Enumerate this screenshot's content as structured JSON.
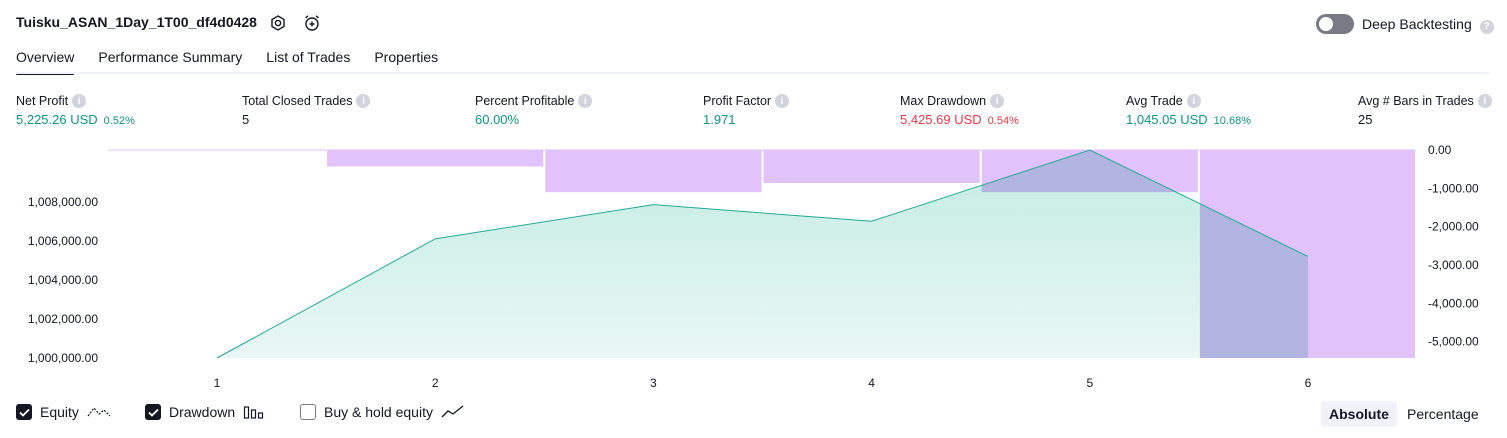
{
  "header": {
    "title": "Tuisku_ASAN_1Day_1T00_df4d0428",
    "toggle_label": "Deep Backtesting",
    "help_glyph": "?"
  },
  "tabs": [
    {
      "label": "Overview",
      "active": true
    },
    {
      "label": "Performance Summary",
      "active": false
    },
    {
      "label": "List of Trades",
      "active": false
    },
    {
      "label": "Properties",
      "active": false
    }
  ],
  "metrics": {
    "net_profit": {
      "label": "Net Profit",
      "value": "5,225.26 USD",
      "pct": "0.52%"
    },
    "total_closed_trades": {
      "label": "Total Closed Trades",
      "value": "5"
    },
    "percent_profitable": {
      "label": "Percent Profitable",
      "value": "60.00%"
    },
    "profit_factor": {
      "label": "Profit Factor",
      "value": "1.971"
    },
    "max_drawdown": {
      "label": "Max Drawdown",
      "value": "5,425.69 USD",
      "pct": "0.54%"
    },
    "avg_trade": {
      "label": "Avg Trade",
      "value": "1,045.05 USD",
      "pct": "10.68%"
    },
    "avg_bars": {
      "label": "Avg # Bars in Trades",
      "value": "25"
    }
  },
  "colors": {
    "equity_line": "#22ab94",
    "equity_fill": "#cdeee7",
    "drawdown": "#e1c2fb",
    "overlap": "#b2b5e0",
    "positive": "#089981",
    "negative": "#f23645"
  },
  "chart_data": {
    "type": "area",
    "x": [
      1,
      2,
      3,
      4,
      5,
      6
    ],
    "series": [
      {
        "name": "Equity",
        "axis": "left",
        "values": [
          1000000,
          1006100,
          1007850,
          1007000,
          1010650,
          1005200
        ]
      },
      {
        "name": "Drawdown",
        "axis": "right",
        "type": "bar",
        "values": [
          0,
          -430,
          -1100,
          -860,
          -1100,
          -5425.69
        ]
      }
    ],
    "left_axis": {
      "ticks": [
        "1,000,000.00",
        "1,002,000.00",
        "1,004,000.00",
        "1,006,000.00",
        "1,008,000.00"
      ],
      "range": [
        1000000,
        1010650
      ]
    },
    "right_axis": {
      "ticks": [
        "0.00",
        "-1,000.00",
        "-2,000.00",
        "-3,000.00",
        "-4,000.00",
        "-5,000.00"
      ],
      "range": [
        -5425.69,
        0
      ]
    },
    "x_ticks": [
      "1",
      "2",
      "3",
      "4",
      "5",
      "6"
    ]
  },
  "legend": {
    "equity": {
      "label": "Equity",
      "checked": true
    },
    "drawdown": {
      "label": "Drawdown",
      "checked": true
    },
    "buy_hold": {
      "label": "Buy & hold equity",
      "checked": false
    }
  },
  "view_mode": {
    "absolute": "Absolute",
    "percentage": "Percentage",
    "selected": "Absolute"
  }
}
